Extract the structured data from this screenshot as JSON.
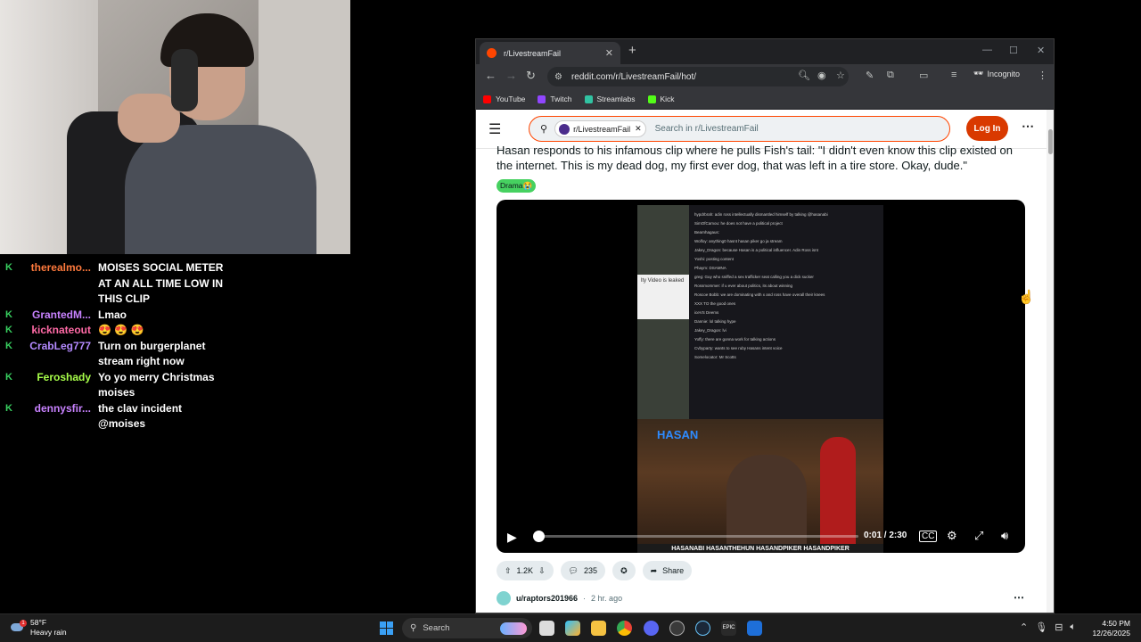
{
  "chat": [
    {
      "user": "therealmo...",
      "color": "#ff7a3d",
      "message": "MOISES SOCIAL METER AT AN ALL TIME LOW IN THIS CLIP",
      "badge": true
    },
    {
      "user": "GrantedM...",
      "color": "#c882ff",
      "message": "Lmao",
      "badge": true
    },
    {
      "user": "kicknateout",
      "color": "#ff6aa6",
      "message": "😍 😍 😍",
      "badge": true
    },
    {
      "user": "CrabLeg777",
      "color": "#b48aff",
      "message": "Turn on burgerplanet stream right now",
      "badge": true
    },
    {
      "user": "Feroshady",
      "color": "#a8ff4a",
      "message": "Yo yo merry Christmas moises",
      "badge": true
    },
    {
      "user": "dennysfir...",
      "color": "#c882ff",
      "message": "the clav incident @moises",
      "badge": true
    }
  ],
  "browser": {
    "tab_title": "r/LivestreamFail",
    "tab_close": "✕",
    "new_tab": "+",
    "url": "reddit.com/r/LivestreamFail/hot/",
    "incognito": "Incognito",
    "bookmarks": [
      {
        "label": "YouTube",
        "color": "#ff0000"
      },
      {
        "label": "Twitch",
        "color": "#9146ff"
      },
      {
        "label": "Streamlabs",
        "color": "#31c3a2"
      },
      {
        "label": "Kick",
        "color": "#53fc18"
      }
    ]
  },
  "reddit": {
    "subreddit_chip": "r/LivestreamFail",
    "search_placeholder": "Search in r/LivestreamFail",
    "login": "Log In",
    "post_title": "Hasan responds to his infamous clip where he pulls Fish's tail: \"I didn't even know this clip existed on the internet. This is my dead dog, my first ever dog, that was left in a tire store. Okay, dude.\"",
    "flair": "Drama😭",
    "video": {
      "time": "0:01 / 2:30",
      "progress": 0.007,
      "stream_label": "HASAN",
      "banner": "HASANABI HASANTHEHUN HASANDPIKER HASANDPIKER",
      "leaked_text": "lty Video is leaked",
      "chat_lines": [
        "hypdrbrah: adin ross intellectually dismantled himself by talking @hasanabi",
        "SimOfCamou: he does not have a political project",
        "Bearnhagaus:",
        "Wolfoy: anything0 hasnt hasan piker go ja stream",
        "Jakey_Dragon: because Hasan is a political influencer. Adin Ross isnt",
        "Yoshi: posting content",
        "Phaym: DSAMNA",
        "greg: Guy who sniffed a sex trafficker seat calling you a dick sucker",
        "Rossmommer: if u ever about politics, its about winning",
        "Roscoe Bobb: we are dominating with x and ross have overall their knees",
        "XXX TO the good ones",
        "iceVS Deems",
        "Dannie: lol talking hype",
        "Jakey_Dragon: lvi",
        "Yoffy: there are gonna work for talking actions",
        "Cvbyparty: wants to see ruby Hasans intent voice",
        "Somelocator: Mr Scotts"
      ]
    },
    "actions": {
      "votes": "1.2K",
      "comments": "235",
      "share": "Share"
    },
    "next_post": {
      "user": "u/raptors201966",
      "time": "2 hr. ago",
      "separator": "·"
    }
  },
  "taskbar": {
    "temperature": "58°F",
    "weather": "Heavy rain",
    "search_label": "Search",
    "time": "4:50 PM",
    "date": "12/26/2025"
  }
}
